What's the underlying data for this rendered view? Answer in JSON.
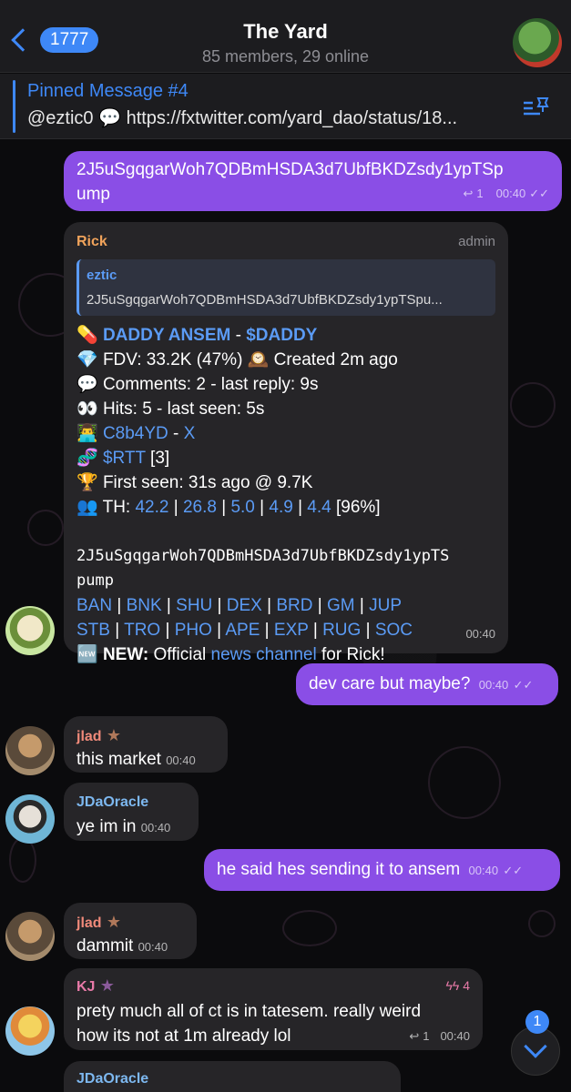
{
  "header": {
    "back_count": "1777",
    "title": "The Yard",
    "subtitle": "85 members, 29 online"
  },
  "pinned": {
    "title": "Pinned Message #4",
    "text": "@eztic0 💬 https://fxtwitter.com/yard_dao/status/18..."
  },
  "messages": {
    "m1": {
      "text": "2J5uSgqgarWoh7QDBmHSDA3d7UbfBKDZsdy1ypTSpump",
      "line1": "2J5uSgqgarWoh7QDBmHSDA3d7UbfBKDZsdy1ypTSp",
      "line2": "ump",
      "replies": "1",
      "time": "00:40"
    },
    "rick": {
      "sender": "Rick",
      "role": "admin",
      "reply_name": "eztic",
      "reply_text": "2J5uSgqgarWoh7QDBmHSDA3d7UbfBKDZsdy1ypTSpu...",
      "token_name": "DADDY ANSEM",
      "token_sep": " - ",
      "token_ticker": "$DADDY",
      "fdv": "FDV: 33.2K (47%) ",
      "created": "Created 2m ago",
      "comments": "Comments: 2 - last reply: 9s",
      "hits": "Hits: 5 - last seen: 5s",
      "dev": "C8b4YD",
      "dev_sep": " - ",
      "dev_x": "X",
      "rtt": "$RTT",
      "rtt_count": " [3]",
      "first_seen": "First seen: 31s ago @ 9.7K",
      "th_label": "TH: ",
      "th_values": [
        "42.2",
        "26.8",
        "5.0",
        "4.9",
        "4.4"
      ],
      "th_pct": " [96%]",
      "ca_line1": "2J5uSgqgarWoh7QDBmHSDA3d7UbfBKDZsdy1ypTS",
      "ca_line2": "pump",
      "links_row1": [
        "BAN",
        "BNK",
        "SHU",
        "DEX",
        "BRD",
        "GM",
        "JUP"
      ],
      "links_row2": [
        "STB",
        "TRO",
        "PHO",
        "APE",
        "EXP",
        "RUG",
        "SOC"
      ],
      "new_label": "NEW:",
      "new_pre": " Official ",
      "new_link": "news channel",
      "new_post": " for Rick!",
      "time": "00:40"
    },
    "m3": {
      "text": "dev care but maybe?",
      "time": "00:40"
    },
    "m4": {
      "sender": "jlad",
      "text": "this market",
      "time": "00:40"
    },
    "m5": {
      "sender": "JDaOracle",
      "text": "ye im in",
      "time": "00:40"
    },
    "m6": {
      "text": "he said hes sending it to ansem",
      "time": "00:40"
    },
    "m7": {
      "sender": "jlad",
      "text": "dammit",
      "time": "00:40"
    },
    "m8": {
      "sender": "KJ",
      "boosts": "4",
      "line1": "prety much all of ct is in tatesem. really weird",
      "line2": "how its not at 1m already lol",
      "replies": "1",
      "time": "00:40"
    },
    "m9": {
      "sender": "JDaOracle"
    }
  },
  "scroll": {
    "unread": "1"
  },
  "colors": {
    "accent": "#3e88f7",
    "outgoing": "#8a4ee6",
    "incoming": "#262528",
    "rick_name": "#f0a35b",
    "jlad_name": "#f08a7a",
    "oracle_name": "#7db8f0",
    "kj_name": "#e87aa8"
  }
}
